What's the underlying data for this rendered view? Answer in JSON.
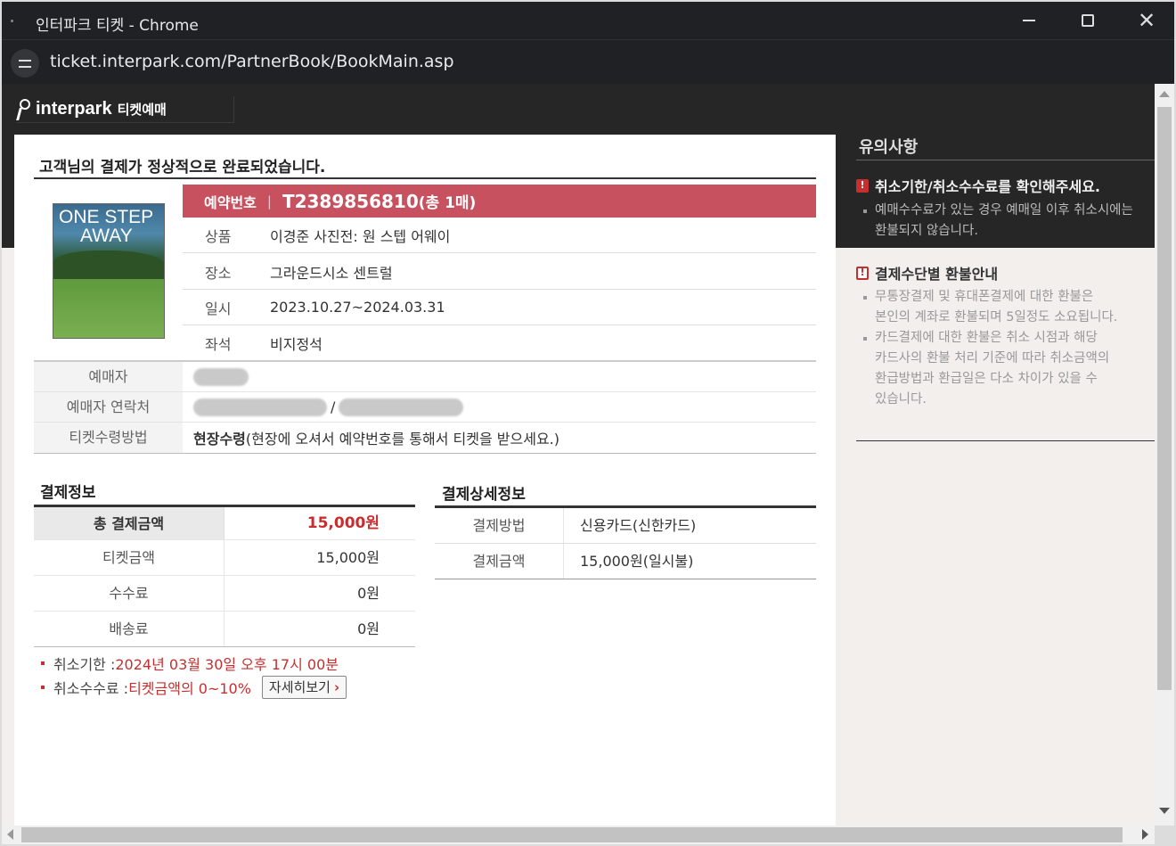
{
  "window": {
    "title": "인터파크 티켓 - Chrome",
    "url": "ticket.interpark.com/PartnerBook/BookMain.asp"
  },
  "header": {
    "brand": "interpark",
    "brand_sub": "티켓예매"
  },
  "main": {
    "complete_title": "고객님의 결제가 정상적으로 완료되었습니다.",
    "poster": {
      "line1": "ONE STEP",
      "line2": "AWAY"
    },
    "reservation": {
      "label": "예약번호",
      "separator": "|",
      "number": "T2389856810",
      "count": "(총 1매)"
    },
    "info_rows": [
      {
        "label": "상품",
        "value": "이경준 사진전: 원 스텝 어웨이"
      },
      {
        "label": "장소",
        "value": "그라운드시소 센트럴"
      },
      {
        "label": "일시",
        "value": "2023.10.27~2024.03.31"
      },
      {
        "label": "좌석",
        "value": "비지정석"
      }
    ],
    "buyer": {
      "name_label": "예매자",
      "contact_label": "예매자 연락처",
      "contact_separator": "/",
      "pickup_label": "티켓수령방법",
      "pickup_value_strong": "현장수령",
      "pickup_value_rest": "(현장에 오셔서 예약번호를 통해서 티켓을 받으세요.)"
    },
    "payment_info": {
      "title": "결제정보",
      "rows": [
        {
          "label": "총 결제금액",
          "value": "15,000원"
        },
        {
          "label": "티켓금액",
          "value": "15,000원"
        },
        {
          "label": "수수료",
          "value": "0원"
        },
        {
          "label": "배송료",
          "value": "0원"
        }
      ]
    },
    "payment_detail": {
      "title": "결제상세정보",
      "rows": [
        {
          "label": "결제방법",
          "value": "신용카드(신한카드)"
        },
        {
          "label": "결제금액",
          "value": "15,000원(일시불)"
        }
      ]
    },
    "notes": {
      "deadline_label": "취소기한 : ",
      "deadline_value": "2024년 03월 30일 오후 17시 00분",
      "fee_label": "취소수수료 : ",
      "fee_value": "티켓금액의 0~10%",
      "more_button": "자세히보기"
    }
  },
  "notice": {
    "title": "유의사항",
    "heading1": "취소기한/취소수수료를 확인해주세요.",
    "item1_line1": "예매수수료가 있는 경우 예매일 이후 취소시에는",
    "item1_line2": "환불되지 않습니다.",
    "heading2": "결제수단별 환불안내",
    "item2_line1": "무통장결제 및 휴대폰결제에 대한 환불은",
    "item2_line2": "본인의 계좌로 환불되며 5일정도 소요됩니다.",
    "item3_line1": "카드결제에 대한 환불은 취소 시점과 해당",
    "item3_line2": "카드사의 환불 처리 기준에 따라 취소금액의",
    "item3_line3": "환급방법과 환급일은 다소 차이가 있을 수",
    "item3_line4": "있습니다.",
    "warn_glyph": "!"
  },
  "colors": {
    "accent": "#c8515f",
    "price_red": "#c62f2f",
    "dark_band": "#262626"
  },
  "icons": {
    "close": "close-icon",
    "maximize": "maximize-icon",
    "minimize": "minimize-icon",
    "site_info": "site-info-icon",
    "warning": "warning-icon",
    "chevron": "chevron-right-icon"
  }
}
